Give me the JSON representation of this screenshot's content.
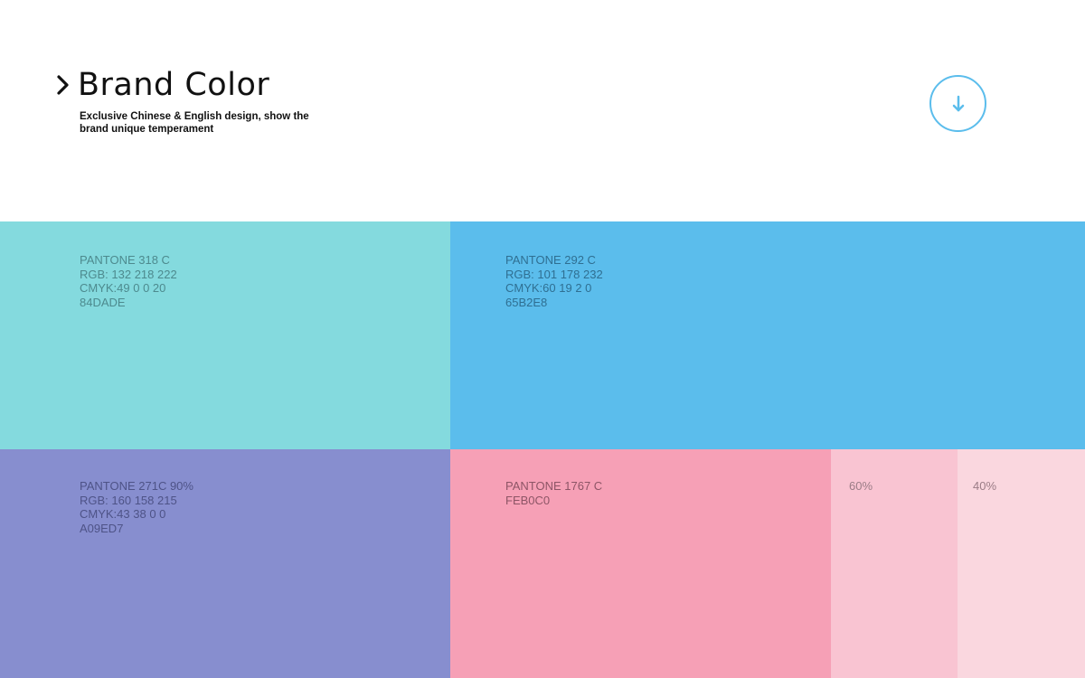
{
  "header": {
    "title": "Brand Color",
    "subtitle": "Exclusive Chinese & English design, show the brand unique temperament",
    "icons": {
      "title_marker": "chevron-right-icon",
      "download": "arrow-down-icon"
    },
    "accent_color": "#5BBDEC"
  },
  "colors": {
    "teal": {
      "pantone": "PANTONE 318 C",
      "rgb": "RGB: 132 218 222",
      "cmyk": "CMYK:49 0 0 20",
      "hex": "84DADE",
      "fill": "#84DADE"
    },
    "blue": {
      "pantone": "PANTONE 292 C",
      "rgb": "RGB: 101 178 232",
      "cmyk": "CMYK:60 19 2 0",
      "hex": "65B2E8",
      "fill": "#5BBDEC"
    },
    "purple": {
      "pantone": "PANTONE 271C 90%",
      "rgb": "RGB: 160 158 215",
      "cmyk": "CMYK:43 38 0 0",
      "hex": "A09ED7",
      "fill": "#878ECF"
    },
    "pink": {
      "pantone": "PANTONE 1767 C",
      "hex": "FEB0C0",
      "fill": "#F6A0B6",
      "tints": [
        {
          "label": "60%",
          "fill": "#F9C4D2"
        },
        {
          "label": "40%",
          "fill": "#FAD7DF"
        }
      ]
    }
  }
}
